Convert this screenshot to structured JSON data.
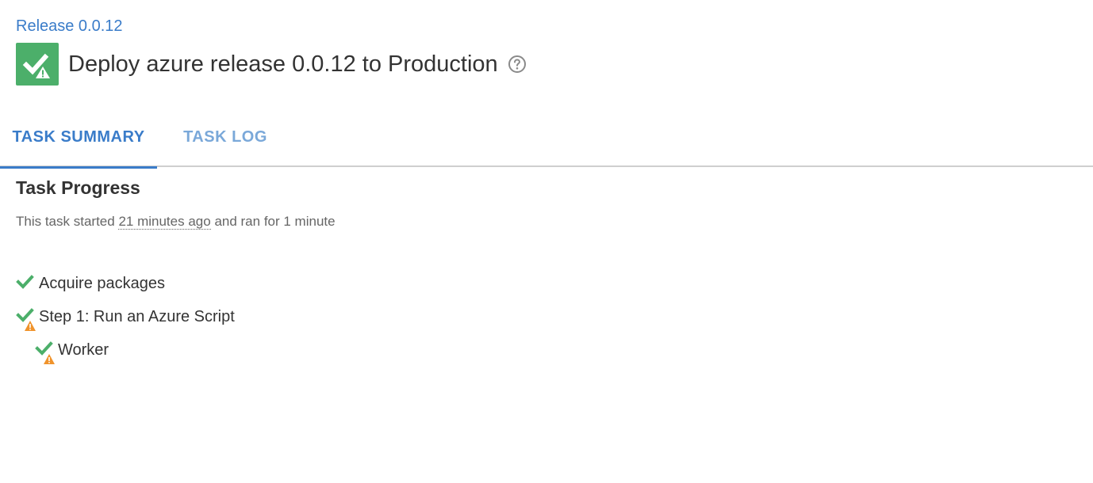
{
  "breadcrumb": "Release 0.0.12",
  "header": {
    "title": "Deploy azure release 0.0.12 to Production",
    "status_icon": "success-with-warning-icon",
    "help_icon": "help-circle-icon"
  },
  "tabs": [
    {
      "label": "TASK SUMMARY",
      "active": true
    },
    {
      "label": "TASK LOG",
      "active": false
    }
  ],
  "progress": {
    "title": "Task Progress",
    "info_prefix": "This task started",
    "started": "21 minutes ago",
    "info_suffix": "and ran for 1 minute"
  },
  "steps": [
    {
      "label": "Acquire packages",
      "status": "success",
      "icon": "check-icon"
    },
    {
      "label": "Step 1: Run an Azure Script",
      "status": "success-with-warning",
      "icon": "check-warning-icon"
    },
    {
      "label": "Worker",
      "status": "success-with-warning",
      "icon": "check-warning-icon"
    }
  ],
  "colors": {
    "accent": "#3a7cc9",
    "success": "#4caf6a",
    "warning": "#f0932b"
  }
}
